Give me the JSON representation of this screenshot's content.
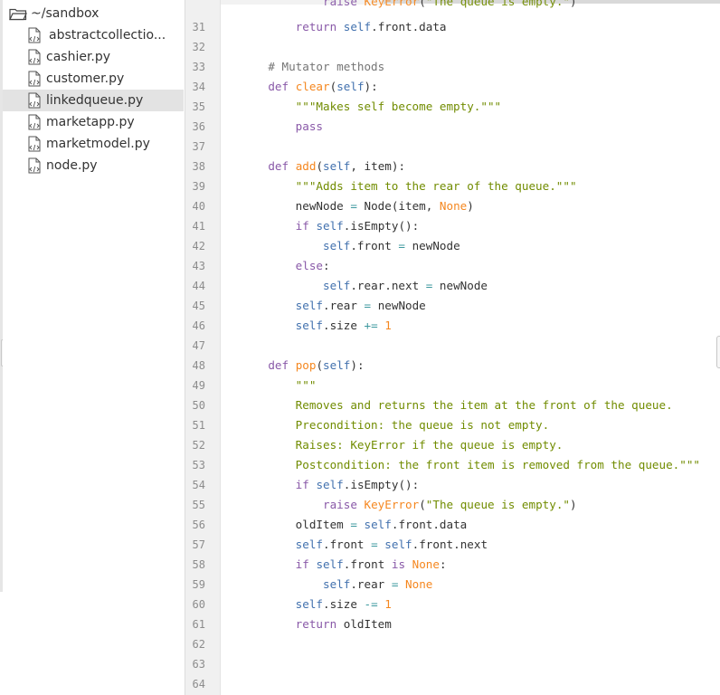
{
  "sidebar": {
    "root_label": "~/sandbox",
    "items": [
      {
        "name": "abstractcollectio..."
      },
      {
        "name": "cashier.py"
      },
      {
        "name": "customer.py"
      },
      {
        "name": "linkedqueue.py",
        "selected": true
      },
      {
        "name": "marketapp.py"
      },
      {
        "name": "marketmodel.py"
      },
      {
        "name": "node.py"
      }
    ]
  },
  "editor": {
    "partial_top_line": "            raise KeyError(\"The queue is empty.\")",
    "lines": [
      {
        "number": "31",
        "text": "        return self.front.data"
      },
      {
        "number": "32",
        "text": ""
      },
      {
        "number": "33",
        "text": "    # Mutator methods"
      },
      {
        "number": "34",
        "text": "    def clear(self):"
      },
      {
        "number": "35",
        "text": "        \"\"\"Makes self become empty.\"\"\""
      },
      {
        "number": "36",
        "text": "        pass"
      },
      {
        "number": "37",
        "text": ""
      },
      {
        "number": "38",
        "text": "    def add(self, item):"
      },
      {
        "number": "39",
        "text": "        \"\"\"Adds item to the rear of the queue.\"\"\""
      },
      {
        "number": "40",
        "text": "        newNode = Node(item, None)"
      },
      {
        "number": "41",
        "text": "        if self.isEmpty():"
      },
      {
        "number": "42",
        "text": "            self.front = newNode"
      },
      {
        "number": "43",
        "text": "        else:"
      },
      {
        "number": "44",
        "text": "            self.rear.next = newNode"
      },
      {
        "number": "45",
        "text": "        self.rear = newNode"
      },
      {
        "number": "46",
        "text": "        self.size += 1"
      },
      {
        "number": "47",
        "text": ""
      },
      {
        "number": "48",
        "text": "    def pop(self):"
      },
      {
        "number": "49",
        "text": "        \"\"\""
      },
      {
        "number": "50",
        "text": "        Removes and returns the item at the front of the queue."
      },
      {
        "number": "51",
        "text": "        Precondition: the queue is not empty."
      },
      {
        "number": "52",
        "text": "        Raises: KeyError if the queue is empty."
      },
      {
        "number": "53",
        "text": "        Postcondition: the front item is removed from the queue.\"\"\""
      },
      {
        "number": "54",
        "text": "        if self.isEmpty():"
      },
      {
        "number": "55",
        "text": "            raise KeyError(\"The queue is empty.\")"
      },
      {
        "number": "56",
        "text": "        oldItem = self.front.data"
      },
      {
        "number": "57",
        "text": "        self.front = self.front.next"
      },
      {
        "number": "58",
        "text": "        if self.front is None:"
      },
      {
        "number": "59",
        "text": "            self.rear = None"
      },
      {
        "number": "60",
        "text": "        self.size -= 1"
      },
      {
        "number": "61",
        "text": "        return oldItem"
      },
      {
        "number": "62",
        "text": ""
      },
      {
        "number": "63",
        "text": ""
      },
      {
        "number": "64",
        "text": ""
      }
    ]
  },
  "colors": {
    "keyword": "#8959a8",
    "self": "#4271ae",
    "function": "#f5871f",
    "string": "#718c00",
    "comment": "#757575",
    "operator": "#3e999f",
    "number": "#f5871f",
    "selected_row": "#e3e3e3",
    "gutter": "#f0f0f0"
  },
  "icons": {
    "root": "folder-open-icon",
    "file": "python-file-icon"
  }
}
